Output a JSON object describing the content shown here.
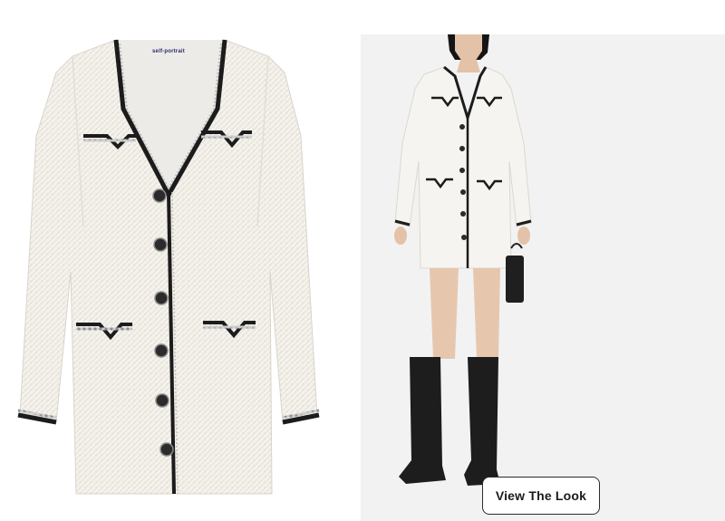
{
  "left_image": {
    "brand_label": "self-portrait",
    "colors": {
      "tweed": "#f4f1ea",
      "trim": "#1c1c1c",
      "button": "#2b2b2b"
    }
  },
  "right_image": {
    "colors": {
      "background": "#f2f2f2",
      "boots": "#1d1d1d",
      "skin": "#e8cbb4"
    }
  },
  "cta": {
    "label": "View The Look"
  }
}
